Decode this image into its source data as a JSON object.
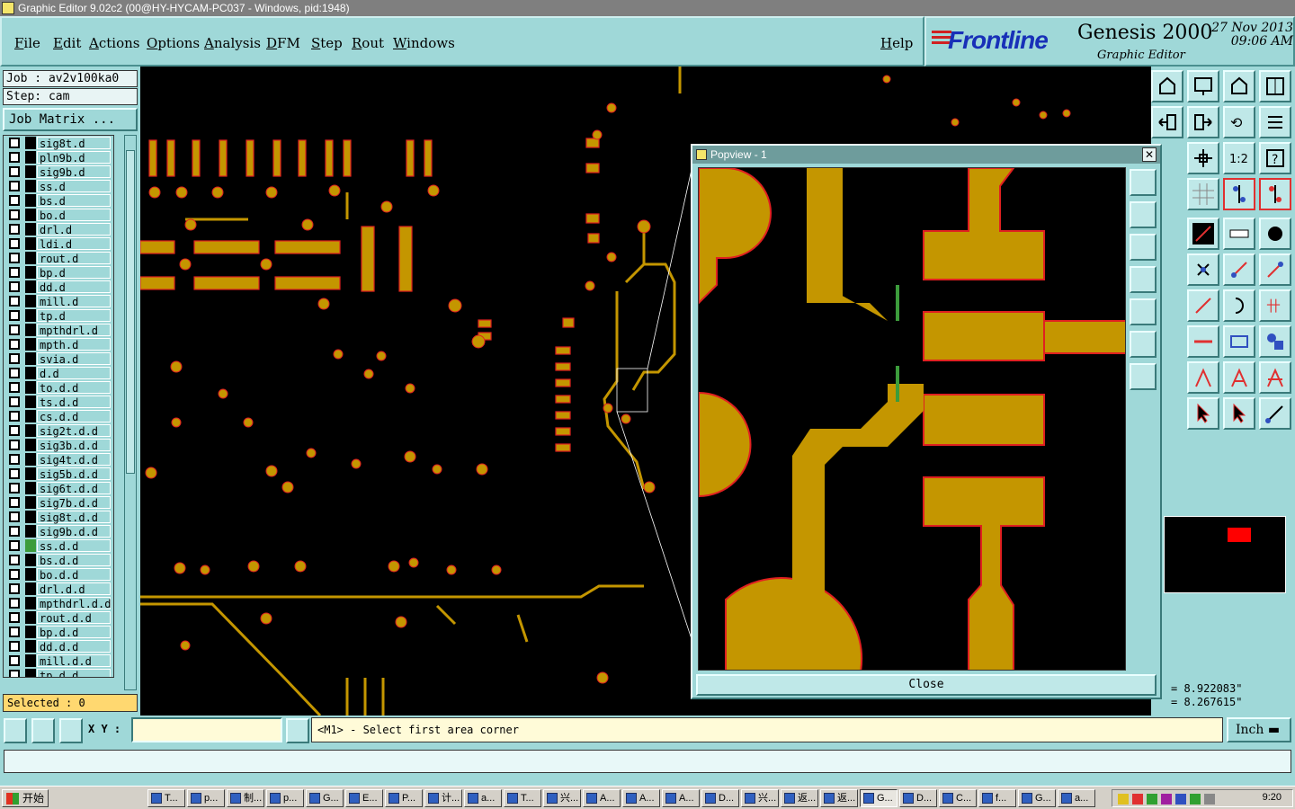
{
  "window": {
    "title": "Graphic Editor 9.02c2 (00@HY-HYCAM-PC037 - Windows, pid:1948)"
  },
  "menu": [
    "File",
    "Edit",
    "Actions",
    "Options",
    "Analysis",
    "DFM",
    "Step",
    "Rout",
    "Windows"
  ],
  "help_label": "Help",
  "brand": {
    "logo_text": "Frontline",
    "product": "Genesis 2000",
    "date": "27 Nov 2013",
    "time": "09:06 AM",
    "subtitle": "Graphic Editor"
  },
  "job": {
    "job_label": "Job : av2v100ka0",
    "step_label": "Step: cam",
    "matrix_button": "Job Matrix ..."
  },
  "layers": [
    {
      "name": "sig8t.d"
    },
    {
      "name": "pln9b.d"
    },
    {
      "name": "sig9b.d"
    },
    {
      "name": "ss.d"
    },
    {
      "name": "bs.d"
    },
    {
      "name": "bo.d"
    },
    {
      "name": "drl.d"
    },
    {
      "name": "ldi.d"
    },
    {
      "name": "rout.d"
    },
    {
      "name": "bp.d"
    },
    {
      "name": "dd.d"
    },
    {
      "name": "mill.d"
    },
    {
      "name": "tp.d"
    },
    {
      "name": "mpthdrl.d"
    },
    {
      "name": "mpth.d"
    },
    {
      "name": "svia.d"
    },
    {
      "name": "d.d"
    },
    {
      "name": "to.d.d"
    },
    {
      "name": "ts.d.d"
    },
    {
      "name": "cs.d.d"
    },
    {
      "name": "sig2t.d.d"
    },
    {
      "name": "sig3b.d.d"
    },
    {
      "name": "sig4t.d.d"
    },
    {
      "name": "sig5b.d.d"
    },
    {
      "name": "sig6t.d.d"
    },
    {
      "name": "sig7b.d.d"
    },
    {
      "name": "sig8t.d.d"
    },
    {
      "name": "sig9b.d.d"
    },
    {
      "name": "ss.d.d",
      "active": true
    },
    {
      "name": "bs.d.d"
    },
    {
      "name": "bo.d.d"
    },
    {
      "name": "drl.d.d"
    },
    {
      "name": "mpthdrl.d.d"
    },
    {
      "name": "rout.d.d"
    },
    {
      "name": "bp.d.d"
    },
    {
      "name": "dd.d.d"
    },
    {
      "name": "mill.d.d"
    },
    {
      "name": "tp.d.d"
    }
  ],
  "selected_label": "Selected : 0",
  "popview": {
    "title": "Popview - 1",
    "close_x": "✕",
    "close_label": "Close"
  },
  "coords": {
    "x": "= 8.922083\"",
    "y": "= 8.267615\""
  },
  "command": {
    "xy_label": "X Y :",
    "xy_value": "",
    "message": "<M1> - Select first area corner",
    "unit": "Inch"
  },
  "colors": {
    "copper": "#c49600",
    "outline": "#e02020",
    "panel": "#9fd8d8",
    "accent_green": "#3c9c3c"
  },
  "tool_icons": [
    "home-view-icon",
    "zoom-home-icon",
    "zoom-in-icon",
    "zoom-out-icon",
    "panel-icon",
    "reset-icon",
    "grid-icon",
    "snap-icon",
    "cursor-icon",
    "measure-icon",
    "fit-icon",
    "ratio-icon",
    "help-icon",
    "select-icon",
    "delete-icon",
    "move-icon",
    "rotate-icon",
    "line-icon",
    "arc-icon",
    "text-icon",
    "lock-icon",
    "arrow-icon"
  ],
  "taskbar": {
    "start_label": "开始",
    "tasks": [
      "T...",
      "p...",
      "制...",
      "p...",
      "G...",
      "E...",
      "P...",
      "计...",
      "a...",
      "T...",
      "兴...",
      "A...",
      "A...",
      "A...",
      "D...",
      "兴...",
      "返...",
      "返...",
      "G...",
      "D...",
      "C...",
      "f...",
      "G...",
      "a..."
    ],
    "clock": "9:20"
  }
}
